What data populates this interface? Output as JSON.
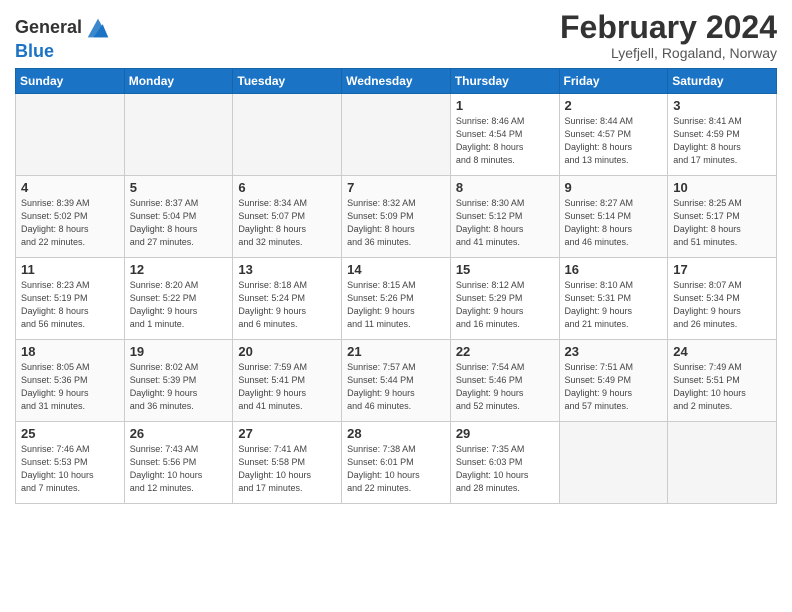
{
  "header": {
    "logo_line1": "General",
    "logo_line2": "Blue",
    "month_title": "February 2024",
    "location": "Lyefjell, Rogaland, Norway"
  },
  "weekdays": [
    "Sunday",
    "Monday",
    "Tuesday",
    "Wednesday",
    "Thursday",
    "Friday",
    "Saturday"
  ],
  "weeks": [
    [
      {
        "day": "",
        "info": ""
      },
      {
        "day": "",
        "info": ""
      },
      {
        "day": "",
        "info": ""
      },
      {
        "day": "",
        "info": ""
      },
      {
        "day": "1",
        "info": "Sunrise: 8:46 AM\nSunset: 4:54 PM\nDaylight: 8 hours\nand 8 minutes."
      },
      {
        "day": "2",
        "info": "Sunrise: 8:44 AM\nSunset: 4:57 PM\nDaylight: 8 hours\nand 13 minutes."
      },
      {
        "day": "3",
        "info": "Sunrise: 8:41 AM\nSunset: 4:59 PM\nDaylight: 8 hours\nand 17 minutes."
      }
    ],
    [
      {
        "day": "4",
        "info": "Sunrise: 8:39 AM\nSunset: 5:02 PM\nDaylight: 8 hours\nand 22 minutes."
      },
      {
        "day": "5",
        "info": "Sunrise: 8:37 AM\nSunset: 5:04 PM\nDaylight: 8 hours\nand 27 minutes."
      },
      {
        "day": "6",
        "info": "Sunrise: 8:34 AM\nSunset: 5:07 PM\nDaylight: 8 hours\nand 32 minutes."
      },
      {
        "day": "7",
        "info": "Sunrise: 8:32 AM\nSunset: 5:09 PM\nDaylight: 8 hours\nand 36 minutes."
      },
      {
        "day": "8",
        "info": "Sunrise: 8:30 AM\nSunset: 5:12 PM\nDaylight: 8 hours\nand 41 minutes."
      },
      {
        "day": "9",
        "info": "Sunrise: 8:27 AM\nSunset: 5:14 PM\nDaylight: 8 hours\nand 46 minutes."
      },
      {
        "day": "10",
        "info": "Sunrise: 8:25 AM\nSunset: 5:17 PM\nDaylight: 8 hours\nand 51 minutes."
      }
    ],
    [
      {
        "day": "11",
        "info": "Sunrise: 8:23 AM\nSunset: 5:19 PM\nDaylight: 8 hours\nand 56 minutes."
      },
      {
        "day": "12",
        "info": "Sunrise: 8:20 AM\nSunset: 5:22 PM\nDaylight: 9 hours\nand 1 minute."
      },
      {
        "day": "13",
        "info": "Sunrise: 8:18 AM\nSunset: 5:24 PM\nDaylight: 9 hours\nand 6 minutes."
      },
      {
        "day": "14",
        "info": "Sunrise: 8:15 AM\nSunset: 5:26 PM\nDaylight: 9 hours\nand 11 minutes."
      },
      {
        "day": "15",
        "info": "Sunrise: 8:12 AM\nSunset: 5:29 PM\nDaylight: 9 hours\nand 16 minutes."
      },
      {
        "day": "16",
        "info": "Sunrise: 8:10 AM\nSunset: 5:31 PM\nDaylight: 9 hours\nand 21 minutes."
      },
      {
        "day": "17",
        "info": "Sunrise: 8:07 AM\nSunset: 5:34 PM\nDaylight: 9 hours\nand 26 minutes."
      }
    ],
    [
      {
        "day": "18",
        "info": "Sunrise: 8:05 AM\nSunset: 5:36 PM\nDaylight: 9 hours\nand 31 minutes."
      },
      {
        "day": "19",
        "info": "Sunrise: 8:02 AM\nSunset: 5:39 PM\nDaylight: 9 hours\nand 36 minutes."
      },
      {
        "day": "20",
        "info": "Sunrise: 7:59 AM\nSunset: 5:41 PM\nDaylight: 9 hours\nand 41 minutes."
      },
      {
        "day": "21",
        "info": "Sunrise: 7:57 AM\nSunset: 5:44 PM\nDaylight: 9 hours\nand 46 minutes."
      },
      {
        "day": "22",
        "info": "Sunrise: 7:54 AM\nSunset: 5:46 PM\nDaylight: 9 hours\nand 52 minutes."
      },
      {
        "day": "23",
        "info": "Sunrise: 7:51 AM\nSunset: 5:49 PM\nDaylight: 9 hours\nand 57 minutes."
      },
      {
        "day": "24",
        "info": "Sunrise: 7:49 AM\nSunset: 5:51 PM\nDaylight: 10 hours\nand 2 minutes."
      }
    ],
    [
      {
        "day": "25",
        "info": "Sunrise: 7:46 AM\nSunset: 5:53 PM\nDaylight: 10 hours\nand 7 minutes."
      },
      {
        "day": "26",
        "info": "Sunrise: 7:43 AM\nSunset: 5:56 PM\nDaylight: 10 hours\nand 12 minutes."
      },
      {
        "day": "27",
        "info": "Sunrise: 7:41 AM\nSunset: 5:58 PM\nDaylight: 10 hours\nand 17 minutes."
      },
      {
        "day": "28",
        "info": "Sunrise: 7:38 AM\nSunset: 6:01 PM\nDaylight: 10 hours\nand 22 minutes."
      },
      {
        "day": "29",
        "info": "Sunrise: 7:35 AM\nSunset: 6:03 PM\nDaylight: 10 hours\nand 28 minutes."
      },
      {
        "day": "",
        "info": ""
      },
      {
        "day": "",
        "info": ""
      }
    ]
  ]
}
